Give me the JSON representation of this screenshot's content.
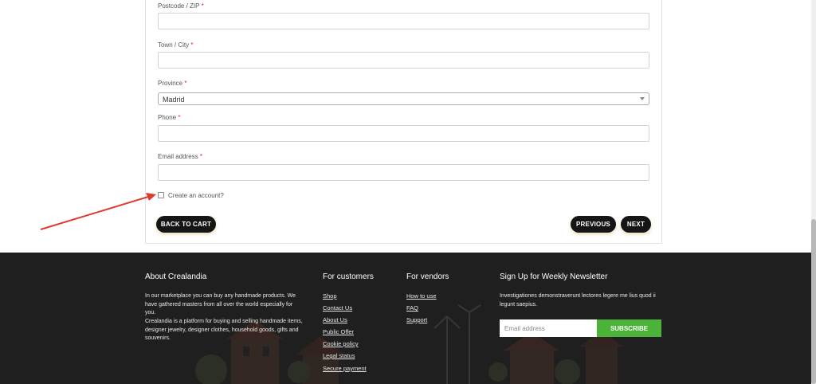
{
  "form": {
    "postcode_label": "Postcode / ZIP",
    "town_label": "Town / City",
    "province_label": "Province",
    "province_value": "Madrid",
    "phone_label": "Phone",
    "email_label": "Email address",
    "required_mark": "*",
    "create_account_label": "Create an account?",
    "back_to_cart": "BACK TO CART",
    "previous": "PREVIOUS",
    "next": "NEXT"
  },
  "footer": {
    "about": {
      "title": "About Crealandia",
      "text1": "In our marketplace you can buy any handmade products. We have gathered masters from all over the world especially for you.",
      "text2": "Crealandia is a platform for buying and selling handmade items, designer jewelry, designer clothes, household goods, gifts and souvenirs."
    },
    "customers": {
      "title": "For customers",
      "links": [
        "Shop",
        "Contact Us",
        "About Us",
        "Public Offer",
        "Cookie policy",
        "Legal status",
        "Secure payment"
      ]
    },
    "vendors": {
      "title": "For vendors",
      "links": [
        "How to use",
        "FAQ",
        "Support"
      ]
    },
    "newsletter": {
      "title": "Sign Up for Weekly Newsletter",
      "text": "Investigationes demonstraverunt lectores legere me lius quod ii legunt saepius.",
      "placeholder": "Email address",
      "button": "SUBSCRIBE"
    }
  },
  "colors": {
    "dark": "#151515",
    "footer_bg": "#1f1f1f",
    "accent_green": "#4bb337",
    "required_red": "#d9262b",
    "annotation_red": "#e03b2f"
  }
}
